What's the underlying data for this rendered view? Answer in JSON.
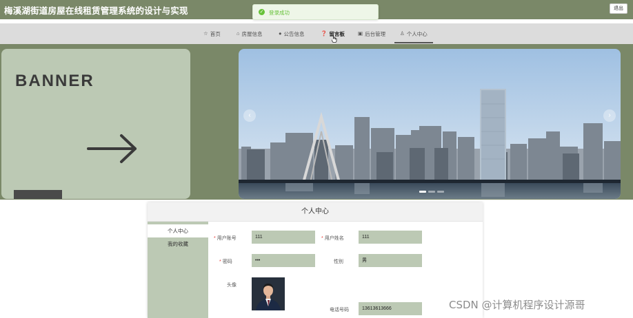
{
  "header": {
    "site_title": "梅溪湖街道房屋在线租赁管理系统的设计与实现",
    "logout_label": "退出"
  },
  "toast": {
    "message": "登录成功",
    "icon": "check-circle-icon",
    "color": "#67c23a"
  },
  "nav": {
    "items": [
      {
        "label": "首页",
        "icon": "star-icon"
      },
      {
        "label": "房屋信息",
        "icon": "house-icon"
      },
      {
        "label": "公告信息",
        "icon": "info-icon"
      },
      {
        "label": "留言板",
        "icon": "question-icon"
      },
      {
        "label": "后台管理",
        "icon": "calendar-icon"
      },
      {
        "label": "个人中心",
        "icon": "user-icon"
      }
    ],
    "active_index": 5
  },
  "banner": {
    "word": "BANNER",
    "carousel": {
      "slide_count": 3,
      "active_slide": 1
    }
  },
  "profile": {
    "title": "个人中心",
    "menu": [
      {
        "label": "个人中心",
        "active": true
      },
      {
        "label": "我的收藏",
        "active": false
      }
    ],
    "fields": {
      "account_label": "用户账号",
      "account_value": "111",
      "name_label": "用户姓名",
      "name_value": "111",
      "password_label": "密码",
      "password_value": "•••",
      "gender_label": "性别",
      "gender_value": "男",
      "avatar_label": "头像",
      "phone_label": "电话号码",
      "phone_value": "13613613666"
    }
  },
  "watermark": "CSDN @计算机程序设计源哥",
  "colors": {
    "brand": "#7a8868",
    "accent_light": "#bcc9b4",
    "nav_bg": "#dcdcdc",
    "required": "#e53935"
  }
}
